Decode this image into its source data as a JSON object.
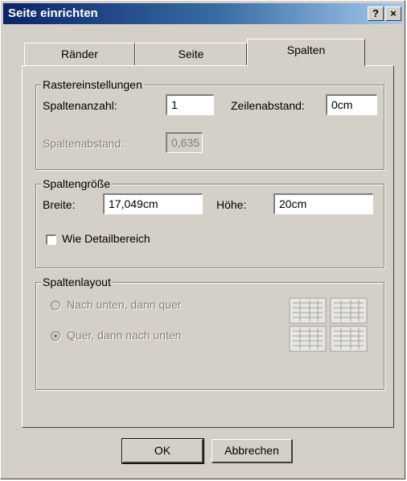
{
  "window": {
    "title": "Seite einrichten",
    "help_glyph": "?",
    "close_glyph": "×"
  },
  "tabs": [
    {
      "label": "Ränder"
    },
    {
      "label": "Seite"
    },
    {
      "label": "Spalten",
      "active": true
    }
  ],
  "grid_settings": {
    "legend": "Rastereinstellungen",
    "columns_label": "Spaltenanzahl:",
    "columns_value": "1",
    "row_spacing_label": "Zeilenabstand:",
    "row_spacing_value": "0cm",
    "column_spacing_label": "Spaltenabstand:",
    "column_spacing_value": "0,635"
  },
  "column_size": {
    "legend": "Spaltengröße",
    "width_label": "Breite:",
    "width_value": "17,049cm",
    "height_label": "Höhe:",
    "height_value": "20cm",
    "same_as_detail_label": "Wie Detailbereich",
    "same_as_detail_checked": false
  },
  "column_layout": {
    "legend": "Spaltenlayout",
    "option_down_then_across": "Nach unten, dann quer",
    "option_across_then_down": "Quer, dann nach unten",
    "selected": "across_then_down"
  },
  "buttons": {
    "ok": "OK",
    "cancel": "Abbrechen"
  },
  "colors": {
    "face": "#d4d0c8",
    "title_start": "#0a246a",
    "title_end": "#a6caf0",
    "disabled_text": "#808080"
  }
}
